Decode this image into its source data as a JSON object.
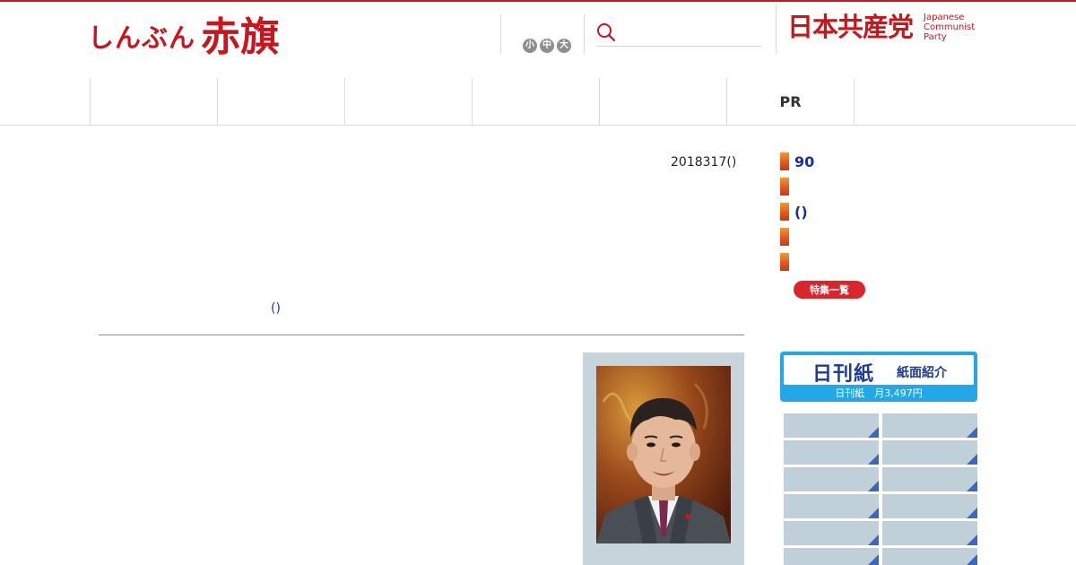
{
  "header": {
    "logo_kana": "しんぶん",
    "logo_kanji": "赤旗",
    "font_sizes": [
      "小",
      "中",
      "大"
    ],
    "search_placeholder": "",
    "party_name": "日本共産党",
    "party_name_en": [
      "Japanese",
      "Communist",
      "Party"
    ]
  },
  "nav": {
    "items": [
      "",
      "",
      "",
      "",
      "",
      "PR",
      ""
    ]
  },
  "article": {
    "date": "2018317()",
    "link_text": "()",
    "photo_alt": "speaker photo"
  },
  "sidebar": {
    "features": [
      "90",
      "",
      "()",
      "",
      ""
    ],
    "feature_list_button": "特集一覧",
    "nikkan": {
      "title": "日刊紙",
      "subtitle": "紙面紹介",
      "price": "日刊紙　月3,497円"
    }
  },
  "colors": {
    "brand_red": "#c8161d",
    "link_blue": "#1a2fa0",
    "nikkan_blue": "#22a8e8"
  }
}
